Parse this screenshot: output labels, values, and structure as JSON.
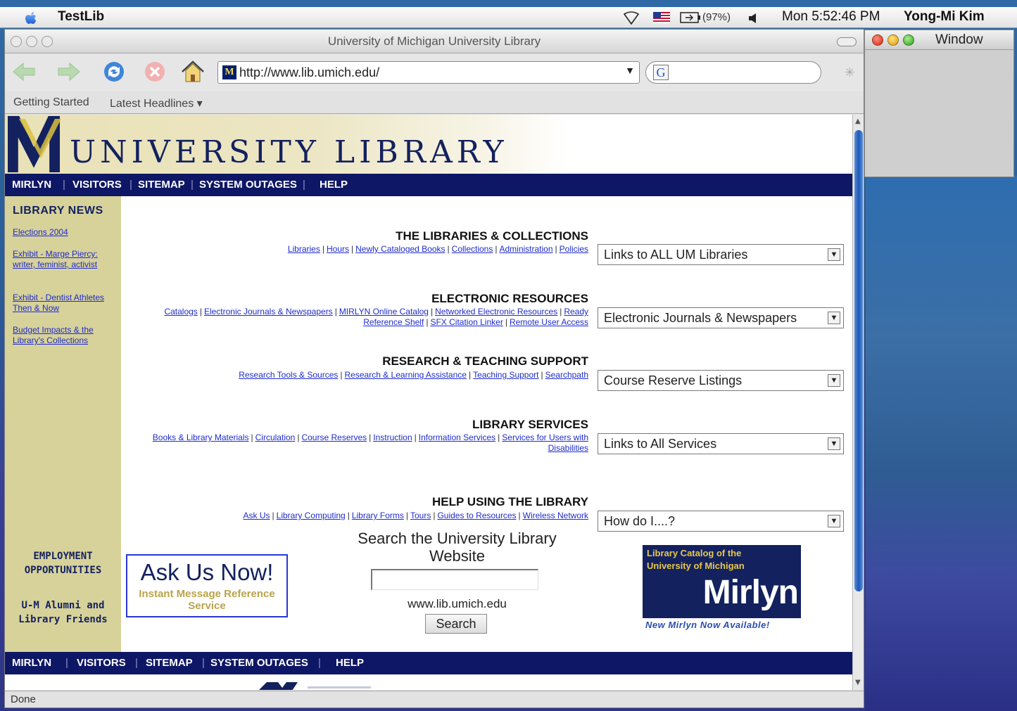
{
  "menubar": {
    "app_name": "TestLib",
    "battery": "(97%)",
    "clock": "Mon 5:52:46 PM",
    "user": "Yong-Mi Kim"
  },
  "second_window": {
    "title": "Window"
  },
  "browser": {
    "window_title": "University of Michigan University Library",
    "url": "http://www.lib.umich.edu/",
    "google_letter": "G",
    "bookmarks": [
      "Getting Started",
      "Latest Headlines ▾"
    ],
    "status": "Done"
  },
  "page": {
    "banner_word": "UNIVERSITY LIBRARY",
    "nav": [
      "MIRLYN",
      "VISITORS",
      "SITEMAP",
      "SYSTEM OUTAGES",
      "HELP"
    ],
    "sidebar": {
      "heading": "LIBRARY NEWS",
      "links": [
        "Elections 2004",
        "Exhibit - Marge Piercy: writer, feminist, activist",
        "Exhibit - Dentist Athletes Then & Now",
        "Budget Impacts & the Library's Collections"
      ],
      "employment": "EMPLOYMENT OPPORTUNITIES",
      "alumni": "U-M Alumni and Library Friends"
    },
    "sections": [
      {
        "title": "THE LIBRARIES & COLLECTIONS",
        "links": [
          "Libraries",
          "Hours",
          "Newly Cataloged Books",
          "Collections",
          "Administration",
          "Policies"
        ],
        "dropdown": "Links to ALL UM Libraries"
      },
      {
        "title": "ELECTRONIC RESOURCES",
        "links": [
          "Catalogs",
          "Electronic Journals & Newspapers",
          "MIRLYN Online Catalog",
          "Networked Electronic Resources",
          "Ready Reference Shelf",
          "SFX Citation Linker",
          "Remote User Access"
        ],
        "dropdown": "Electronic Journals & Newspapers"
      },
      {
        "title": "RESEARCH & TEACHING SUPPORT",
        "links": [
          "Research Tools & Sources",
          "Research & Learning Assistance",
          "Teaching Support",
          "Searchpath"
        ],
        "dropdown": "Course Reserve Listings"
      },
      {
        "title": "LIBRARY SERVICES",
        "links": [
          "Books & Library Materials",
          "Circulation",
          "Course Reserves",
          "Instruction",
          "Information Services",
          "Services for Users with Disabilities"
        ],
        "dropdown": "Links to All Services"
      },
      {
        "title": "HELP USING THE LIBRARY",
        "links": [
          "Ask Us",
          "Library Computing",
          "Library Forms",
          "Tours",
          "Guides to Resources",
          "Wireless Network"
        ],
        "dropdown": "How do I....?"
      }
    ],
    "askus": {
      "title": "Ask Us Now!",
      "subtitle": "Instant Message Reference Service"
    },
    "search": {
      "title": "Search the University Library Website",
      "domain": "www.lib.umich.edu",
      "button": "Search",
      "value": ""
    },
    "mirlyn": {
      "caption": "Library Catalog of the University of Michigan",
      "name": "Mirlyn",
      "note": "New Mirlyn Now Available!"
    }
  },
  "colors": {
    "navy": "#0e1765",
    "sidebar": "#d7d29a",
    "link": "#1f2ccc",
    "gold": "#e7c94a"
  }
}
